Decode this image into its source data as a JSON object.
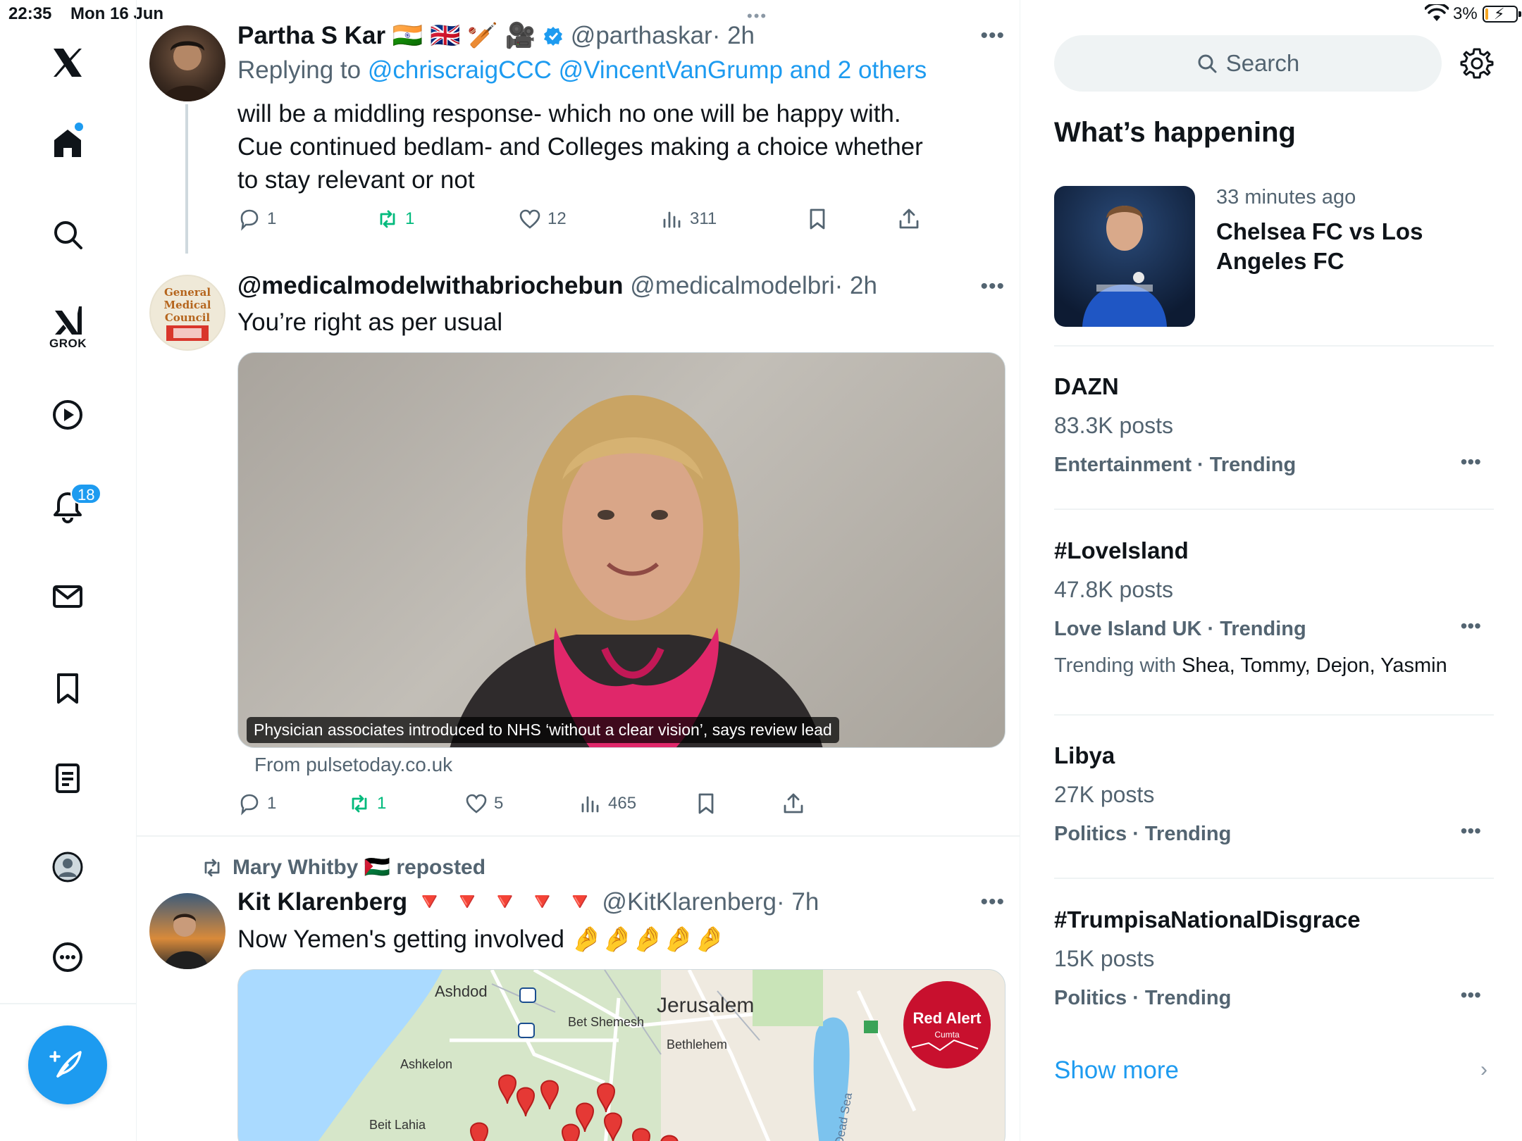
{
  "status_bar": {
    "time": "22:35",
    "date": "Mon 16 Jun",
    "battery": "3%",
    "multitask": "•••"
  },
  "nav": {
    "grok_label": "GROK",
    "notifications_badge": "18"
  },
  "tweets": [
    {
      "name": "Partha S Kar",
      "emoji": "🇮🇳 🇬🇧 🏏 🎥",
      "handle": "@parthaskar",
      "time": "· 2h",
      "reply_prefix": "Replying to",
      "reply_targets": "@chriscraigCCC @VincentVanGrump and 2 others",
      "text": "will be a middling response- which no one will be happy with. Cue continued bedlam- and Colleges making a choice whether to stay relevant or not",
      "replies": "1",
      "reposts": "1",
      "likes": "12",
      "views": "311"
    },
    {
      "name": "@medicalmodelwithabriochebun",
      "handle": "@medicalmodelbri",
      "time": "· 2h",
      "text": "You’re right as per usual",
      "media_caption": "Physician associates introduced to NHS ‘without a clear vision’, says review lead",
      "source": "From pulsetoday.co.uk",
      "replies": "1",
      "reposts": "1",
      "likes": "5",
      "views": "465"
    },
    {
      "repost_by": "Mary Whitby 🇵🇸 reposted",
      "name": "Kit Klarenberg",
      "emoji": "🔻 🔻 🔻 🔻 🔻",
      "handle": "@KitKlarenberg",
      "time": "· 7h",
      "text": "Now Yemen's getting involved 🤌🤌🤌🤌🤌",
      "map": {
        "places": [
          "Ashdod",
          "Bet Shemesh",
          "Jerusalem",
          "Bethlehem",
          "Ashkelon",
          "Beit Lahia",
          "Dead Sea"
        ],
        "badge_title": "Red Alert",
        "badge_sub": "Cumta"
      }
    }
  ],
  "sidebar": {
    "search_placeholder": "Search",
    "section_title": "What’s happening",
    "news": {
      "time": "33 minutes ago",
      "title": "Chelsea FC vs Los Angeles FC"
    },
    "trends": [
      {
        "name": "DAZN",
        "count": "83.3K posts",
        "category": "Entertainment · Trending"
      },
      {
        "name": "#LoveIsland",
        "count": "47.8K posts",
        "category": "Love Island UK · Trending",
        "with_label": "Trending with",
        "with_names": "Shea, Tommy, Dejon, Yasmin"
      },
      {
        "name": "Libya",
        "count": "27K posts",
        "category": "Politics · Trending"
      },
      {
        "name": "#TrumpisaNationalDisgrace",
        "count": "15K posts",
        "category": "Politics · Trending"
      }
    ],
    "show_more": "Show more"
  },
  "colors": {
    "accent": "#1d9bf0",
    "repost_green": "#00ba7c",
    "secondary_text": "#536471"
  }
}
